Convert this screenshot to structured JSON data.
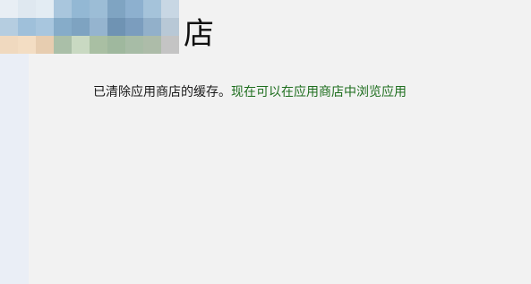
{
  "header": {
    "title_visible_char": "店"
  },
  "message": {
    "text": "已清除应用商店的缓存。",
    "link_text": "现在可以在应用商店中浏览应用"
  },
  "colors": {
    "background": "#f2f2f2",
    "message_text": "#1a1a1a",
    "link_text": "#1e6e1e"
  }
}
